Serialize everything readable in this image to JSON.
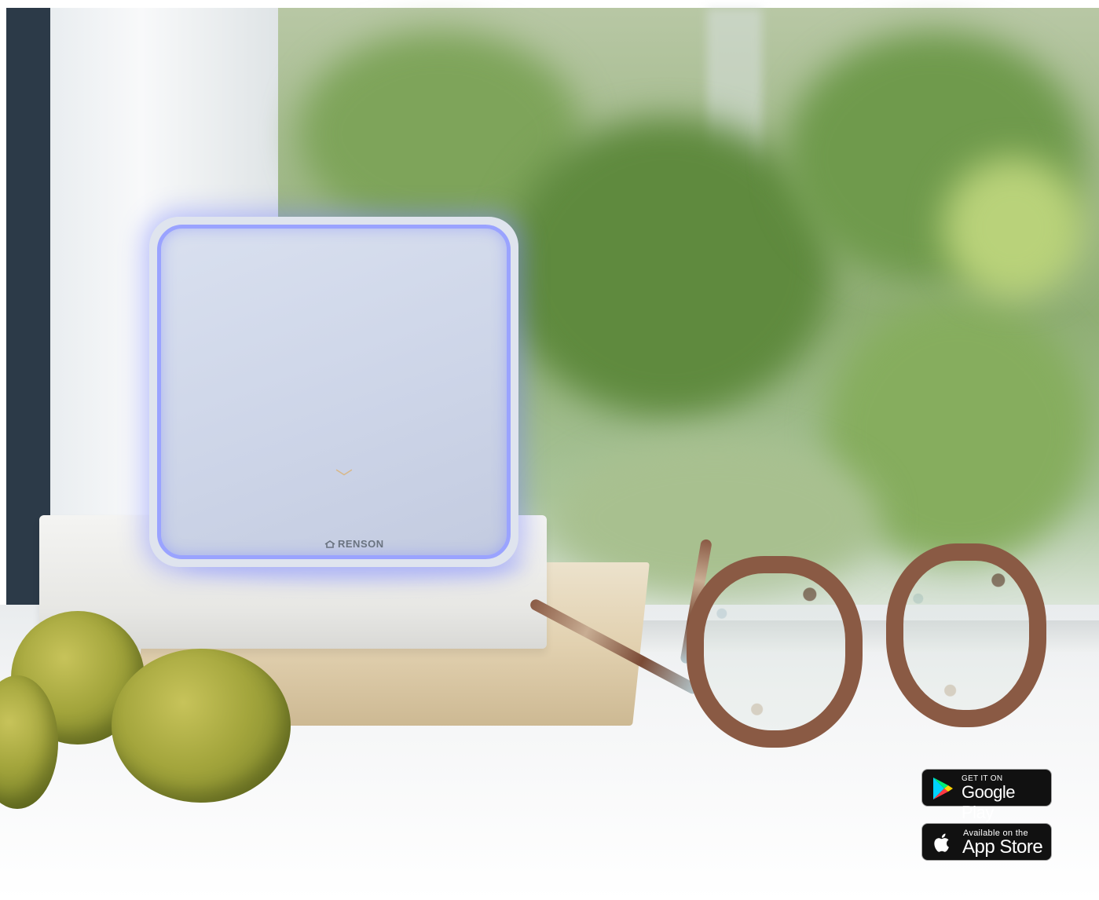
{
  "photo": {
    "device_brand": "RENSON",
    "chevron_glyph": "﹀"
  },
  "badges": {
    "google_play": {
      "small_text": "GET IT ON",
      "big_text": "Google Play",
      "icon": "google-play-icon"
    },
    "app_store": {
      "small_text": "Available on the",
      "big_text": "App Store",
      "icon": "apple-icon"
    }
  },
  "colors": {
    "device_glow": "#9aa3ff",
    "badge_bg": "#111111",
    "foliage": "#8fae74"
  }
}
